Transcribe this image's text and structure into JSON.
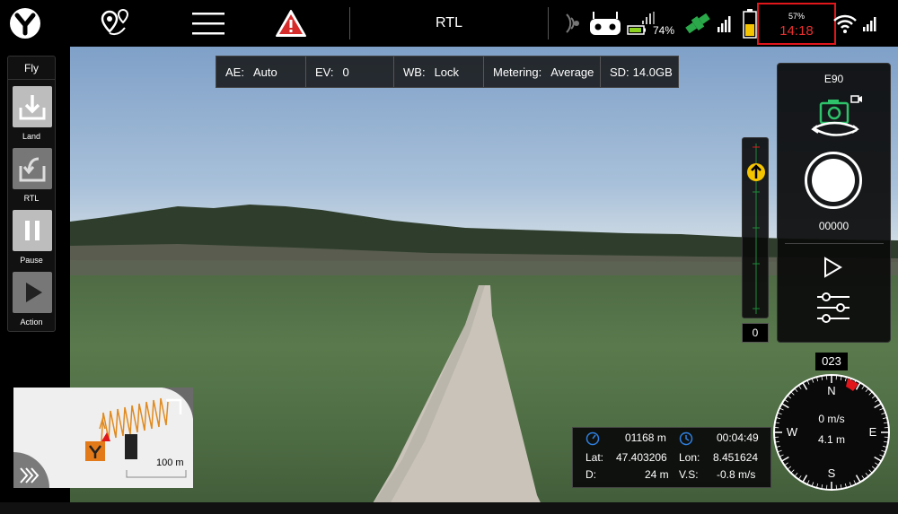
{
  "topbar": {
    "flight_mode": "RTL",
    "controller_battery": "74%",
    "drone_battery_percent": "57%",
    "flight_time_remaining": "14:18"
  },
  "camera_settings": [
    {
      "label": "AE:",
      "value": "Auto"
    },
    {
      "label": "EV:",
      "value": "0"
    },
    {
      "label": "WB:",
      "value": "Lock"
    },
    {
      "label": "Metering:",
      "value": "Average"
    },
    {
      "label": "SD:",
      "value": "14.0GB"
    }
  ],
  "left_panel": {
    "title": "Fly",
    "buttons": [
      {
        "label": "Land",
        "icon": "land-icon"
      },
      {
        "label": "RTL",
        "icon": "rtl-icon"
      },
      {
        "label": "Pause",
        "icon": "pause-icon"
      },
      {
        "label": "Action",
        "icon": "play-icon"
      }
    ]
  },
  "right_panel": {
    "camera_model": "E90",
    "shot_count": "00000"
  },
  "altitude_slider": {
    "value": "0"
  },
  "compass": {
    "heading": "023",
    "speed": "0 m/s",
    "distance": "4.1 m",
    "directions": [
      "N",
      "E",
      "S",
      "W"
    ]
  },
  "telemetry": {
    "distance": "01168 m",
    "flight_time": "00:04:49",
    "lat_label": "Lat:",
    "lat_value": "47.403206",
    "lon_label": "Lon:",
    "lon_value": "8.451624",
    "d_label": "D:",
    "d_value": "24 m",
    "vs_label": "V.S:",
    "vs_value": "-0.8 m/s"
  },
  "minimap": {
    "scale": "100 m"
  },
  "colors": {
    "accent_red": "#e0161b",
    "camera_green": "#2ec26a",
    "gps_green": "#2aa84a",
    "battery_yellow": "#f5c400",
    "warning_red": "#d62b2b"
  }
}
